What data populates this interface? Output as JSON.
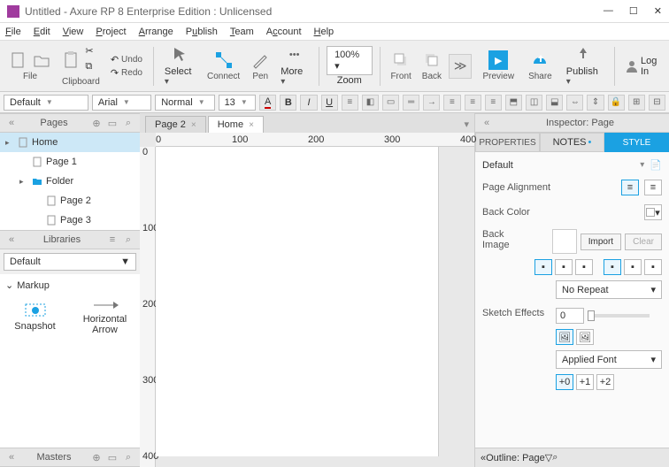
{
  "window": {
    "title": "Untitled - Axure RP 8 Enterprise Edition : Unlicensed"
  },
  "menu": [
    "File",
    "Edit",
    "View",
    "Project",
    "Arrange",
    "Publish",
    "Team",
    "Account",
    "Help"
  ],
  "toolbar": {
    "file": "File",
    "clipboard": "Clipboard",
    "undo": "Undo",
    "redo": "Redo",
    "select": "Select",
    "connect": "Connect",
    "pen": "Pen",
    "more": "More",
    "zoom_value": "100%",
    "zoom": "Zoom",
    "front": "Front",
    "back": "Back",
    "preview": "Preview",
    "share": "Share",
    "publish": "Publish",
    "login": "Log In"
  },
  "format": {
    "style": "Default",
    "font": "Arial",
    "weight": "Normal",
    "size": "13"
  },
  "pages_panel": {
    "title": "Pages",
    "tree": [
      {
        "label": "Home",
        "type": "page",
        "level": 0,
        "expand": "▸",
        "selected": true
      },
      {
        "label": "Page 1",
        "type": "page",
        "level": 1
      },
      {
        "label": "Folder",
        "type": "folder",
        "level": 1,
        "expand": "▸"
      },
      {
        "label": "Page 2",
        "type": "page",
        "level": 2
      },
      {
        "label": "Page 3",
        "type": "page",
        "level": 2
      }
    ]
  },
  "libraries_panel": {
    "title": "Libraries",
    "selected": "Default",
    "category": "Markup",
    "items": [
      {
        "label": "Snapshot"
      },
      {
        "label": "Horizontal Arrow"
      }
    ]
  },
  "masters_panel": {
    "title": "Masters"
  },
  "canvas": {
    "tabs": [
      {
        "label": "Page 2",
        "active": false
      },
      {
        "label": "Home",
        "active": true
      }
    ],
    "h_ticks": [
      "0",
      "100",
      "200",
      "300",
      "400"
    ],
    "v_ticks": [
      "0",
      "100",
      "200",
      "300",
      "400"
    ]
  },
  "inspector": {
    "title": "Inspector: Page",
    "tabs": [
      "PROPERTIES",
      "NOTES",
      "STYLE"
    ],
    "active_tab": "STYLE",
    "style_name": "Default",
    "page_alignment": "Page Alignment",
    "back_color": "Back Color",
    "back_image": "Back Image",
    "import": "Import",
    "clear": "Clear",
    "repeat": "No Repeat",
    "sketch_effects": "Sketch Effects",
    "sketch_value": "0",
    "applied_font": "Applied Font",
    "letter_spacing": [
      "+0",
      "+1",
      "+2"
    ]
  },
  "outline": {
    "title": "Outline: Page"
  }
}
